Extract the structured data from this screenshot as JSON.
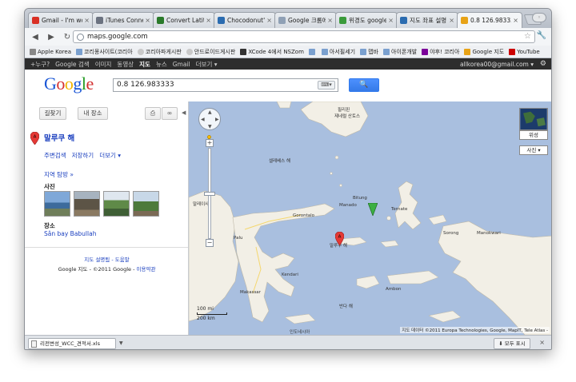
{
  "browser": {
    "tabs": [
      {
        "label": "Gmail - I'm won",
        "color": "#d93025"
      },
      {
        "label": "iTunes Connect",
        "color": "#6b7280"
      },
      {
        "label": "Convert Latitude",
        "color": "#2a7a2a"
      },
      {
        "label": "Chocodonut's N",
        "color": "#2b6cb0"
      },
      {
        "label": "Google 크롬에서",
        "color": "#8fa0b5"
      },
      {
        "label": "위경도 google 좌",
        "color": "#3b9b3b"
      },
      {
        "label": "지도 좌표 설명 (",
        "color": "#2b6cb0"
      },
      {
        "label": "0.8 126.983333",
        "color": "#e8a317"
      }
    ],
    "address": "maps.google.com",
    "bookmarks": [
      {
        "label": "Apple Korea",
        "icon": "apple-icon"
      },
      {
        "label": "코리몽사이트(코리아",
        "icon": "folder-icon"
      },
      {
        "label": "코리아파게시판",
        "icon": "globe-icon"
      },
      {
        "label": "안드로이드게시판",
        "icon": "globe-icon"
      },
      {
        "label": "XCode 4에서 NSZom",
        "icon": "apple-icon"
      },
      {
        "label": "",
        "icon": "folder-icon"
      },
      {
        "label": "아서필세기",
        "icon": "folder-icon"
      },
      {
        "label": "맵바",
        "icon": "folder-icon"
      },
      {
        "label": "아이폰개발",
        "icon": "folder-icon"
      },
      {
        "label": "야후! 코리아",
        "icon": "yahoo-icon"
      },
      {
        "label": "Google 지도",
        "icon": "google-icon"
      },
      {
        "label": "YouTube",
        "icon": "youtube-icon"
      }
    ]
  },
  "gbar": {
    "items": [
      "+누구?",
      "Google 검색",
      "이미지",
      "동영상",
      "지도",
      "뉴스",
      "Gmail",
      "더보기 ▾"
    ],
    "selected": "지도",
    "email": "allkorea00@gmail.com ▾"
  },
  "search": {
    "logo": "Google",
    "query": "0.8 126.983333",
    "button_label": "🔍"
  },
  "sidebar": {
    "directions_label": "길찾기",
    "my_places_label": "내 장소",
    "result_title": "말루쿠 해",
    "links": [
      "주변검색",
      "저장하기",
      "더보기 ▾"
    ],
    "nearby": "지역 탐방 »",
    "photos_heading": "사진",
    "place_heading": "장소",
    "place_link": "Sân bay Babullah",
    "help_links": "지도 설명됨 - 도움말",
    "copyright": "Google 지도 - ©2011 Google -",
    "terms": "이용약관"
  },
  "map": {
    "satellite_label": "위성",
    "photo_label": "사진",
    "scale_km": "200 km",
    "scale_mi": "100 mi",
    "attribution": "지도 데이터 ©2011 Europa Technologies, Google, MapIT, Tele Atlas -",
    "labels": [
      {
        "text": "말레이사",
        "name": "label-malaysia"
      },
      {
        "text": "필리핀",
        "name": "label-philippines"
      },
      {
        "text": "제네럴 산토스",
        "name": "label-general-santos"
      },
      {
        "text": "셀레베스 해",
        "name": "label-celebes-sea"
      },
      {
        "text": "Bitung",
        "name": "label-bitung"
      },
      {
        "text": "말루쿠 해",
        "name": "label-maluku-sea"
      },
      {
        "text": "Ternate",
        "name": "label-ternate"
      },
      {
        "text": "Manado",
        "name": "label-manado"
      },
      {
        "text": "Gorontalo",
        "name": "label-gorontalo"
      },
      {
        "text": "Palu",
        "name": "label-palu"
      },
      {
        "text": "Sorong",
        "name": "label-sorong"
      },
      {
        "text": "Manokwari",
        "name": "label-manokwari"
      },
      {
        "text": "Ambon",
        "name": "label-ambon"
      },
      {
        "text": "Makassar",
        "name": "label-makassar"
      },
      {
        "text": "반다 해",
        "name": "label-banda-sea"
      },
      {
        "text": "Kendari",
        "name": "label-kendari"
      },
      {
        "text": "인도네시아",
        "name": "label-indonesia"
      }
    ]
  },
  "downloads": {
    "file": "리전변성_WCC_견적서.xls",
    "show_all": "모두 표시"
  }
}
